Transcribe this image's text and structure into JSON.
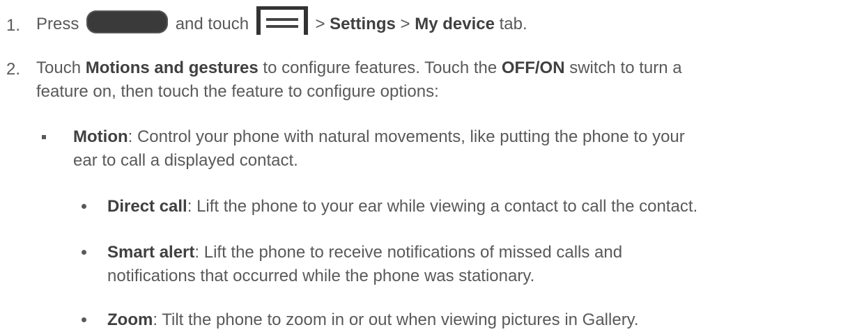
{
  "steps": [
    {
      "number": "1.",
      "t_press": "Press",
      "t_and_touch": "and touch",
      "t_gt1": "> ",
      "b_settings": "Settings",
      "t_gt2": " > ",
      "b_my_device": "My device",
      "t_tab": " tab."
    },
    {
      "number": "2.",
      "t_touch": "Touch ",
      "b_motions": "Motions and gestures",
      "t_mid": " to configure features. Touch the ",
      "b_offon": "OFF/ON",
      "t_end": " switch to turn a",
      "line2": "feature on, then touch the feature to configure options:"
    }
  ],
  "motion": {
    "title": "Motion",
    "desc1": ": Control your phone with natural movements, like putting the phone to your",
    "desc2": "ear to call a displayed contact."
  },
  "sub_items": [
    {
      "title": "Direct call",
      "desc1": ": Lift the phone to your ear while viewing a contact to call the contact."
    },
    {
      "title": "Smart alert",
      "desc1": ": Lift the phone to receive notifications of missed calls and",
      "desc2": "notifications that occurred while the phone was stationary."
    },
    {
      "title": "Zoom",
      "desc1": ": Tilt the phone to zoom in or out when viewing pictures in Gallery."
    }
  ],
  "icons": {
    "home": "home-key-icon",
    "menu": "menu-key-icon"
  }
}
